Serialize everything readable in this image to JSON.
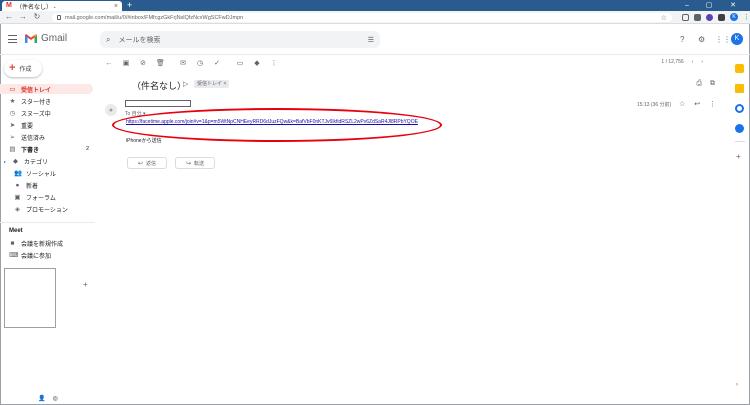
{
  "browser": {
    "tab_title": "（件名なし） - ",
    "tab_close": "×",
    "new_tab": "+",
    "url": "mail.google.com/mail/u/0/#inbox/FMfcgzGkFrjNslQfzNcxWgSCFwDJmpn",
    "minimize": "–",
    "maximize": "▢",
    "close": "✕",
    "profile_initial": "K"
  },
  "gmail": {
    "logo_text": "Gmail",
    "search_placeholder": "メールを検索",
    "avatar_initial": "K"
  },
  "sidebar": {
    "compose_label": "作成",
    "items": [
      {
        "label": "受信トレイ",
        "count": ""
      },
      {
        "label": "スター付き",
        "count": ""
      },
      {
        "label": "スヌーズ中",
        "count": ""
      },
      {
        "label": "重要",
        "count": ""
      },
      {
        "label": "送信済み",
        "count": ""
      },
      {
        "label": "下書き",
        "count": "2"
      },
      {
        "label": "カテゴリ",
        "count": ""
      },
      {
        "label": "ソーシャル",
        "count": ""
      },
      {
        "label": "新着",
        "count": ""
      },
      {
        "label": "フォーラム",
        "count": ""
      },
      {
        "label": "プロモーション",
        "count": ""
      }
    ],
    "meet_heading": "Meet",
    "meet_items": [
      "会議を新規作成",
      "会議に参加"
    ]
  },
  "main": {
    "pager_text": "1 / 12,756",
    "subject": "（件名なし）",
    "label_chip": "受信トレイ ×",
    "to_line": "To 自分 ▾",
    "time": "15:13 (36 分前)",
    "link_text": "https://facetime.apple.com/join#v=1&p=m5WtNpCNHEeyRRD6dJuzFQw&k=BafVbF0nKTJv6lkfidRSZL2wPv6ZdSaR4Jl8RPbYQOE",
    "body_text": "iPhoneから送信",
    "reply_label": "返信",
    "forward_label": "転送"
  },
  "colors": {
    "accent_red": "#d93025",
    "highlight_ellipse": "#e8000c",
    "link_blue": "#1a0dab",
    "chrome_blue": "#2a5b8f"
  }
}
